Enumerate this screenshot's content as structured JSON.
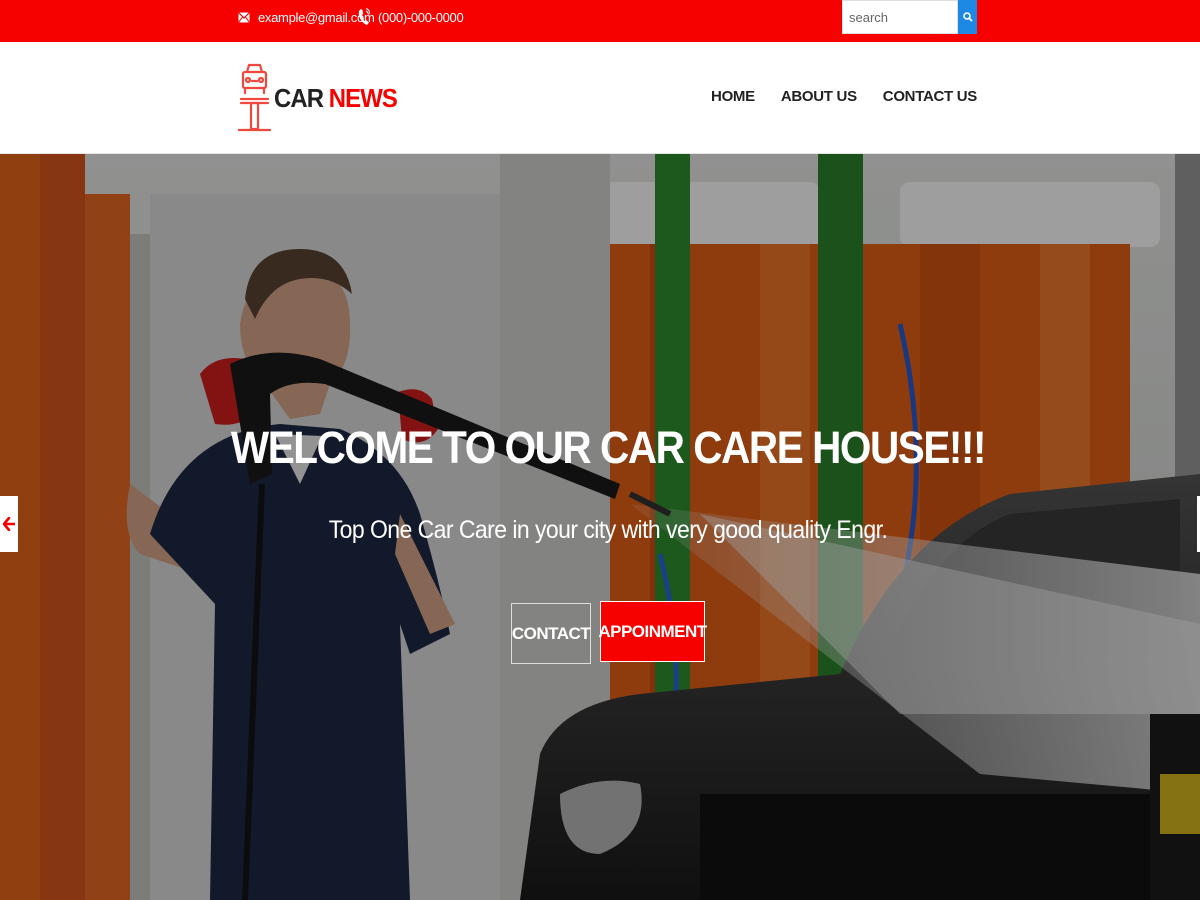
{
  "topbar": {
    "email": "example@gmail.com",
    "phone": "(000)-000-0000",
    "email_icon": "mail-icon",
    "phone_icon": "phone-icon",
    "search_placeholder": "search",
    "search_icon": "search-icon",
    "bg_color": "#f60000",
    "search_btn_color": "#1e88e5"
  },
  "header": {
    "logo_part1": "CAR",
    "logo_part2": "NEWS",
    "logo_icon": "car-lift-icon",
    "nav": [
      {
        "label": "HOME"
      },
      {
        "label": "ABOUT US"
      },
      {
        "label": "CONTACT US"
      }
    ]
  },
  "hero": {
    "title": "WELCOME TO OUR CAR CARE HOUSE!!!",
    "subtitle": "Top One Car Care in your city with very good quality Engr.",
    "btn_contact": "CONTACT",
    "btn_appointment": "APPOINMENT",
    "prev_icon": "arrow-left-icon",
    "next_icon": "arrow-right-icon",
    "accent_color": "#f60000"
  }
}
